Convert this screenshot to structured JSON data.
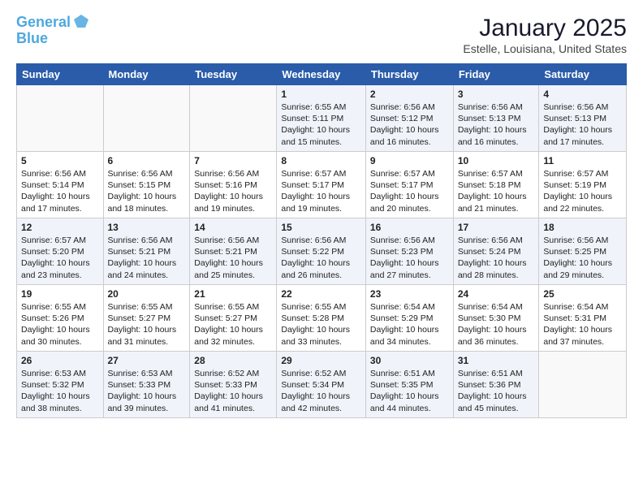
{
  "logo": {
    "line1": "General",
    "line2": "Blue"
  },
  "title": "January 2025",
  "location": "Estelle, Louisiana, United States",
  "days_of_week": [
    "Sunday",
    "Monday",
    "Tuesday",
    "Wednesday",
    "Thursday",
    "Friday",
    "Saturday"
  ],
  "weeks": [
    [
      {
        "day": "",
        "content": ""
      },
      {
        "day": "",
        "content": ""
      },
      {
        "day": "",
        "content": ""
      },
      {
        "day": "1",
        "content": "Sunrise: 6:55 AM\nSunset: 5:11 PM\nDaylight: 10 hours\nand 15 minutes."
      },
      {
        "day": "2",
        "content": "Sunrise: 6:56 AM\nSunset: 5:12 PM\nDaylight: 10 hours\nand 16 minutes."
      },
      {
        "day": "3",
        "content": "Sunrise: 6:56 AM\nSunset: 5:13 PM\nDaylight: 10 hours\nand 16 minutes."
      },
      {
        "day": "4",
        "content": "Sunrise: 6:56 AM\nSunset: 5:13 PM\nDaylight: 10 hours\nand 17 minutes."
      }
    ],
    [
      {
        "day": "5",
        "content": "Sunrise: 6:56 AM\nSunset: 5:14 PM\nDaylight: 10 hours\nand 17 minutes."
      },
      {
        "day": "6",
        "content": "Sunrise: 6:56 AM\nSunset: 5:15 PM\nDaylight: 10 hours\nand 18 minutes."
      },
      {
        "day": "7",
        "content": "Sunrise: 6:56 AM\nSunset: 5:16 PM\nDaylight: 10 hours\nand 19 minutes."
      },
      {
        "day": "8",
        "content": "Sunrise: 6:57 AM\nSunset: 5:17 PM\nDaylight: 10 hours\nand 19 minutes."
      },
      {
        "day": "9",
        "content": "Sunrise: 6:57 AM\nSunset: 5:17 PM\nDaylight: 10 hours\nand 20 minutes."
      },
      {
        "day": "10",
        "content": "Sunrise: 6:57 AM\nSunset: 5:18 PM\nDaylight: 10 hours\nand 21 minutes."
      },
      {
        "day": "11",
        "content": "Sunrise: 6:57 AM\nSunset: 5:19 PM\nDaylight: 10 hours\nand 22 minutes."
      }
    ],
    [
      {
        "day": "12",
        "content": "Sunrise: 6:57 AM\nSunset: 5:20 PM\nDaylight: 10 hours\nand 23 minutes."
      },
      {
        "day": "13",
        "content": "Sunrise: 6:56 AM\nSunset: 5:21 PM\nDaylight: 10 hours\nand 24 minutes."
      },
      {
        "day": "14",
        "content": "Sunrise: 6:56 AM\nSunset: 5:21 PM\nDaylight: 10 hours\nand 25 minutes."
      },
      {
        "day": "15",
        "content": "Sunrise: 6:56 AM\nSunset: 5:22 PM\nDaylight: 10 hours\nand 26 minutes."
      },
      {
        "day": "16",
        "content": "Sunrise: 6:56 AM\nSunset: 5:23 PM\nDaylight: 10 hours\nand 27 minutes."
      },
      {
        "day": "17",
        "content": "Sunrise: 6:56 AM\nSunset: 5:24 PM\nDaylight: 10 hours\nand 28 minutes."
      },
      {
        "day": "18",
        "content": "Sunrise: 6:56 AM\nSunset: 5:25 PM\nDaylight: 10 hours\nand 29 minutes."
      }
    ],
    [
      {
        "day": "19",
        "content": "Sunrise: 6:55 AM\nSunset: 5:26 PM\nDaylight: 10 hours\nand 30 minutes."
      },
      {
        "day": "20",
        "content": "Sunrise: 6:55 AM\nSunset: 5:27 PM\nDaylight: 10 hours\nand 31 minutes."
      },
      {
        "day": "21",
        "content": "Sunrise: 6:55 AM\nSunset: 5:27 PM\nDaylight: 10 hours\nand 32 minutes."
      },
      {
        "day": "22",
        "content": "Sunrise: 6:55 AM\nSunset: 5:28 PM\nDaylight: 10 hours\nand 33 minutes."
      },
      {
        "day": "23",
        "content": "Sunrise: 6:54 AM\nSunset: 5:29 PM\nDaylight: 10 hours\nand 34 minutes."
      },
      {
        "day": "24",
        "content": "Sunrise: 6:54 AM\nSunset: 5:30 PM\nDaylight: 10 hours\nand 36 minutes."
      },
      {
        "day": "25",
        "content": "Sunrise: 6:54 AM\nSunset: 5:31 PM\nDaylight: 10 hours\nand 37 minutes."
      }
    ],
    [
      {
        "day": "26",
        "content": "Sunrise: 6:53 AM\nSunset: 5:32 PM\nDaylight: 10 hours\nand 38 minutes."
      },
      {
        "day": "27",
        "content": "Sunrise: 6:53 AM\nSunset: 5:33 PM\nDaylight: 10 hours\nand 39 minutes."
      },
      {
        "day": "28",
        "content": "Sunrise: 6:52 AM\nSunset: 5:33 PM\nDaylight: 10 hours\nand 41 minutes."
      },
      {
        "day": "29",
        "content": "Sunrise: 6:52 AM\nSunset: 5:34 PM\nDaylight: 10 hours\nand 42 minutes."
      },
      {
        "day": "30",
        "content": "Sunrise: 6:51 AM\nSunset: 5:35 PM\nDaylight: 10 hours\nand 44 minutes."
      },
      {
        "day": "31",
        "content": "Sunrise: 6:51 AM\nSunset: 5:36 PM\nDaylight: 10 hours\nand 45 minutes."
      },
      {
        "day": "",
        "content": ""
      }
    ]
  ]
}
